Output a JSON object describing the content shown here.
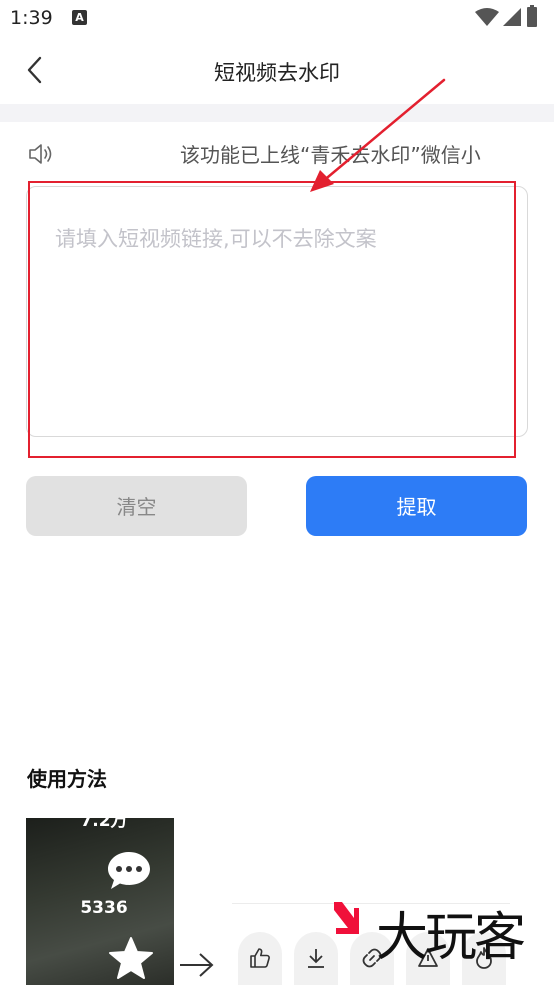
{
  "status_bar": {
    "time": "1:39",
    "notification_glyph": "A",
    "icons": [
      "wifi-icon",
      "signal-icon",
      "battery-icon"
    ]
  },
  "header": {
    "back_icon": "chevron-left-icon",
    "title": "短视频去水印"
  },
  "notice": {
    "icon": "speaker-icon",
    "text": "该功能已上线“青禾去水印”微信小"
  },
  "input": {
    "placeholder": "请填入短视频链接,可以不去除文案",
    "value": ""
  },
  "buttons": {
    "clear_label": "清空",
    "extract_label": "提取"
  },
  "usage": {
    "heading": "使用方法",
    "thumbnail": {
      "views": "7.2万",
      "comment_count": "5336",
      "icons": [
        "comment-icon",
        "star-icon"
      ]
    },
    "action_icons": [
      "thumb-up-icon",
      "download-icon",
      "link-icon",
      "share-icon",
      "flame-icon"
    ],
    "watermark": "大玩客"
  },
  "colors": {
    "accent": "#2d7cf6",
    "annotation": "#e3202f",
    "clear_button_bg": "#e1e1e1"
  }
}
